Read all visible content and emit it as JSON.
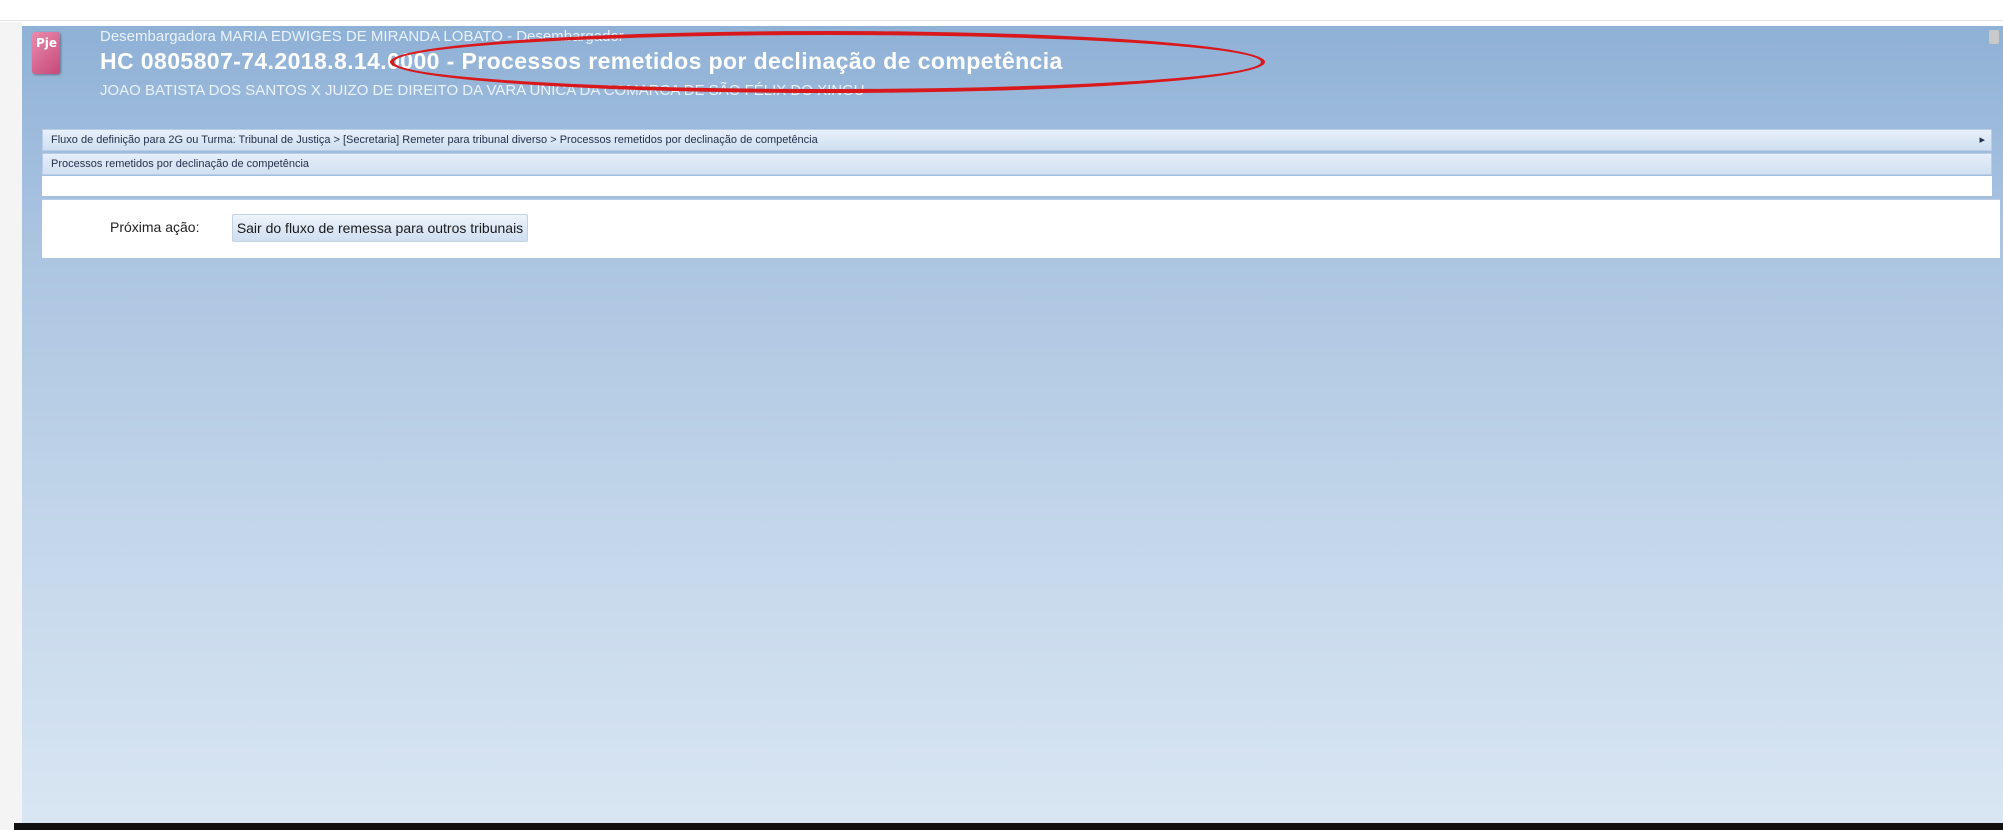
{
  "header": {
    "icon": "document-app-icon",
    "icon_glyph": "Pje",
    "line1": "Desembargadora MARIA EDWIGES DE MIRANDA LOBATO - Desembargador",
    "title": "HC 0805807-74.2018.8.14.0000 - Processos remetidos por declinação de competência",
    "line3": "JOAO BATISTA DOS SANTOS X JUIZO DE DIREITO DA VARA ÚNICA DA COMARCA DE SÃO FÉLIX DO XINGU"
  },
  "breadcrumb": {
    "text": "Fluxo de definição para 2G ou Turma: Tribunal de Justiça > [Secretaria] Remeter para tribunal diverso > Processos remetidos por declinação de competência",
    "toggle": "▸"
  },
  "task": {
    "name": "Processos remetidos por declinação de competência"
  },
  "action": {
    "label": "Próxima ação:",
    "button": "Sair do fluxo de remessa para outros tribunais"
  },
  "annotation": {
    "color": "#d9181c"
  }
}
